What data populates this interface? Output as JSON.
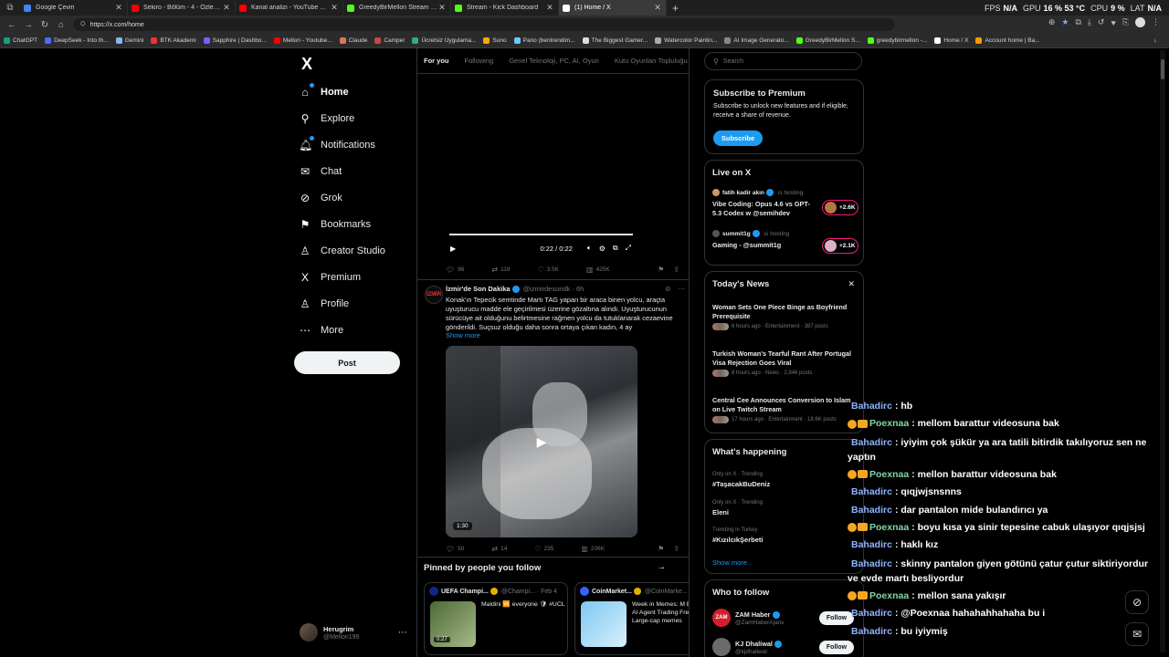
{
  "browser": {
    "tabs": [
      {
        "title": "Google Çeviri",
        "color": "#4285f4",
        "active": false
      },
      {
        "title": "Sekiro - Bölüm - 4 - Özlemiglim !!!",
        "color": "#ff0000",
        "active": false
      },
      {
        "title": "Kanal analizi - YouTube Studio",
        "color": "#ff0000",
        "active": false
      },
      {
        "title": "GreedyBirMellon Stream - Watch Live",
        "color": "#53fc18",
        "active": false
      },
      {
        "title": "Stream - Kick Dashboard",
        "color": "#53fc18",
        "active": false
      },
      {
        "title": "(1) Home / X",
        "color": "#ffffff",
        "active": true
      }
    ],
    "hud": {
      "fps_label": "FPS",
      "fps": "N/A",
      "gpu_label": "GPU",
      "gpu": "16 %  53 °C",
      "cpu_label": "CPU",
      "cpu": "9 %",
      "lat_label": "LAT",
      "lat": "N/A"
    },
    "url": "https://x.com/home",
    "bookmarks": [
      "ChatGPT",
      "DeepSeek - Into th...",
      "Gemini",
      "BTK Akademi",
      "Sapphire | Dashbo...",
      "Mellon - Youtube...",
      "Claude",
      "Camper",
      "Ücretsiz Uygulama...",
      "Suno",
      "Pano (bentrendim...",
      "The Biggest Gamer...",
      "Watercolor Paintin...",
      "AI Image Generato...",
      "GreedyBirMellon S...",
      "greedybirmellon -...",
      "Home / X",
      "Account home | Ba..."
    ]
  },
  "nav": {
    "logo": "X",
    "items": [
      {
        "label": "Home",
        "icon": "⌂",
        "active": true
      },
      {
        "label": "Explore",
        "icon": "⚲"
      },
      {
        "label": "Notifications",
        "icon": "🔔︎"
      },
      {
        "label": "Chat",
        "icon": "✉"
      },
      {
        "label": "Grok",
        "icon": "⊘"
      },
      {
        "label": "Bookmarks",
        "icon": "⚑"
      },
      {
        "label": "Creator Studio",
        "icon": "♙"
      },
      {
        "label": "Premium",
        "icon": "X"
      },
      {
        "label": "Profile",
        "icon": "♙"
      },
      {
        "label": "More",
        "icon": "⋯"
      }
    ],
    "post_label": "Post",
    "account": {
      "name": "Herugrim",
      "handle": "@Mellon199"
    }
  },
  "feed": {
    "tabs": [
      "For you",
      "Following",
      "Genel Teknoloji, PC, AI, Oyun",
      "Kutu Oyunları Topluluğu"
    ],
    "video1": {
      "time": "0:22 / 0:22"
    },
    "post1_actions": {
      "replies": "96",
      "reposts": "118",
      "likes": "3.5K",
      "views": "425K"
    },
    "post2": {
      "avatar_text": "İZMİR",
      "name": "İzmir'de Son Dakika",
      "handle": "@izmirdesondk",
      "age": "· 6h",
      "text": "Konak'ın Tepecik semtinde Martı TAG yapan bir araca binen yolcu, araçta uyuşturucu madde ele geçirilmesi üzerine gözaltına alındı. Uyuşturucunun sürücüye ait olduğunu belirtmesine rağmen yolcu da tutuklanarak cezaevine gönderildi. Suçsuz olduğu daha sonra ortaya çıkan kadın, 4 ay",
      "show_more": "Show more",
      "video_duration": "1:30",
      "actions": {
        "replies": "50",
        "reposts": "14",
        "likes": "235",
        "views": "206K"
      }
    },
    "pinned": {
      "title": "Pinned by people you follow",
      "cards": [
        {
          "name": "UEFA Champi...",
          "handle": "@Champi... · Feb 4",
          "text": "Maldini 🆚 everyone 🛡 #UCL",
          "duration": "0:27"
        },
        {
          "name": "CoinMarket...",
          "handle": "@CoinMarke...",
          "text": "Week in Memes: M Bleed but AI Agent Trading Frenzy Large-cap memes"
        }
      ]
    }
  },
  "sidebar": {
    "search_placeholder": "Search",
    "premium": {
      "title": "Subscribe to Premium",
      "text": "Subscribe to unlock new features and if eligible, receive a share of revenue.",
      "button": "Subscribe"
    },
    "live": {
      "title": "Live on X",
      "items": [
        {
          "host": "fatih kadir akın",
          "status": "is hosting",
          "title": "Vibe Coding: Opus 4.6 vs GPT-5.3 Codex w @semihdev",
          "count": "+2.6K"
        },
        {
          "host": "summit1g",
          "status": "is hosting",
          "title": "Gaming - @summit1g",
          "count": "+2.1K"
        }
      ]
    },
    "news": {
      "title": "Today's News",
      "items": [
        {
          "title": "Woman Sets One Piece Binge as Boyfriend Prerequisite",
          "meta": "6 hours ago · Entertainment · 387 posts"
        },
        {
          "title": "Turkish Woman's Tearful Rant After Portugal Visa Rejection Goes Viral",
          "meta": "8 hours ago · News · 2,946 posts"
        },
        {
          "title": "Central Cee Announces Conversion to Islam on Live Twitch Stream",
          "meta": "17 hours ago · Entertainment · 18.6K posts"
        }
      ]
    },
    "happening": {
      "title": "What's happening",
      "items": [
        {
          "context": "Only on X · Trending",
          "name": "#TaşacakBuDeniz"
        },
        {
          "context": "Only on X · Trending",
          "name": "Eleni"
        },
        {
          "context": "Trending in Turkey",
          "name": "#KızılcıkŞerbeti"
        }
      ],
      "show_more": "Show more"
    },
    "who_to_follow": {
      "title": "Who to follow",
      "items": [
        {
          "name": "ZAM Haber",
          "handle": "@ZamHaberAjans",
          "avatar": "ZAM",
          "button": "Follow"
        },
        {
          "name": "KJ Dhaliwal",
          "handle": "@kjdhaliwal",
          "button": "Follow"
        }
      ]
    }
  },
  "chat": [
    {
      "user": "Bahadirc",
      "cls": "u1",
      "badges": false,
      "msg": ": hb"
    },
    {
      "user": "Poexnaa",
      "cls": "u2",
      "badges": true,
      "msg": ": mellom barattur videosuna bak"
    },
    {
      "user": "Bahadirc",
      "cls": "u1",
      "badges": false,
      "msg": ": iyiyim çok şükür ya ara tatili bitirdik takılıyoruz sen ne yaptın",
      "wrap": true
    },
    {
      "user": "Poexnaa",
      "cls": "u2",
      "badges": true,
      "msg": ": mellon barattur videosuna bak"
    },
    {
      "user": "Bahadirc",
      "cls": "u1",
      "badges": false,
      "msg": ": qıqjwjsnsnns"
    },
    {
      "user": "Bahadirc",
      "cls": "u1",
      "badges": false,
      "msg": ": dar pantalon mide bulandırıcı ya"
    },
    {
      "user": "Poexnaa",
      "cls": "u2",
      "badges": true,
      "msg": ": boyu kısa ya sinir tepesine cabuk ulaşıyor qıqjsjsj"
    },
    {
      "user": "Bahadirc",
      "cls": "u1",
      "badges": false,
      "msg": ": haklı kız"
    },
    {
      "user": "Bahadirc",
      "cls": "u1",
      "badges": false,
      "msg": ": skinny pantalon giyen götünü çatur çutur siktiriyordur ve evde martı besliyordur",
      "wrap": true
    },
    {
      "user": "Poexnaa",
      "cls": "u2",
      "badges": true,
      "msg": ": mellon sana yakışır"
    },
    {
      "user": "Bahadirc",
      "cls": "u1",
      "badges": false,
      "msg": ": @Poexnaa hahahahhahaha bu i"
    },
    {
      "user": "Bahadirc",
      "cls": "u1",
      "badges": false,
      "msg": ": bu iyiymiş"
    }
  ]
}
